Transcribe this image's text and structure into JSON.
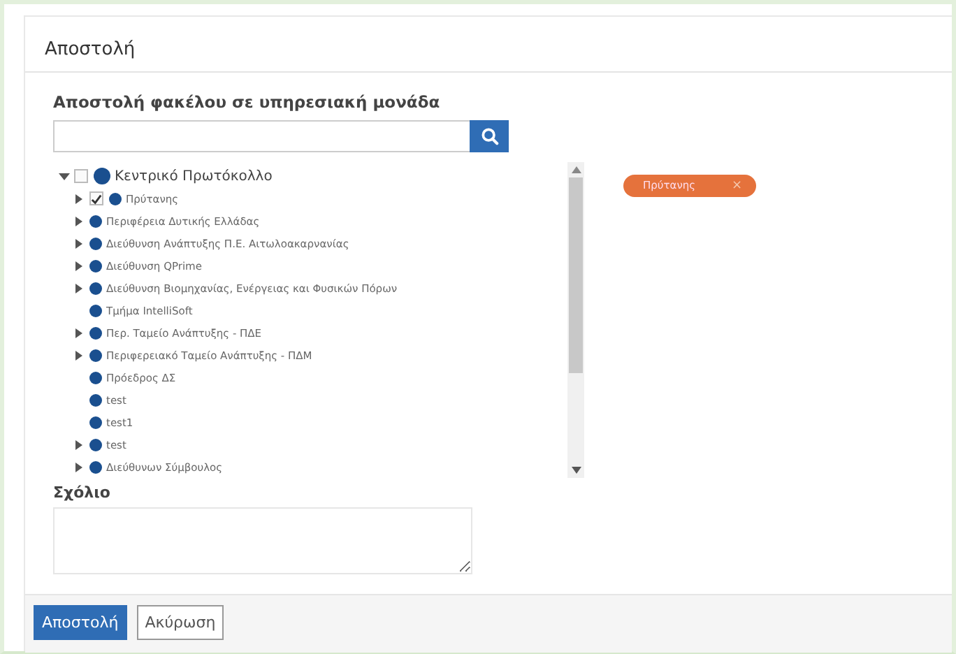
{
  "panel": {
    "title": "Αποστολή"
  },
  "form": {
    "label": "Αποστολή φακέλου σε υπηρεσιακή μονάδα"
  },
  "tree": [
    {
      "label": "Κεντρικό Πρωτόκολλο",
      "kind": "branch",
      "expanded": true,
      "checked": false,
      "children": [
        {
          "label": "Πρύτανης",
          "kind": "branch",
          "expanded": false,
          "checked": true
        },
        {
          "label": "Περιφέρεια Δυτικής Ελλάδας",
          "kind": "branch",
          "expanded": false
        },
        {
          "label": "Διεύθυνση Ανάπτυξης Π.Ε. Αιτωλοακαρνανίας",
          "kind": "branch",
          "expanded": false
        },
        {
          "label": "Διεύθυνση QPrime",
          "kind": "branch",
          "expanded": false
        },
        {
          "label": "Διεύθυνση Βιομηχανίας, Ενέργειας και Φυσικών Πόρων",
          "kind": "branch",
          "expanded": false
        },
        {
          "label": "Τμήμα IntelliSoft",
          "kind": "leaf"
        },
        {
          "label": "Περ. Ταμείο Ανάπτυξης - ΠΔΕ",
          "kind": "branch",
          "expanded": false
        },
        {
          "label": "Περιφερειακό Ταμείο Ανάπτυξης - ΠΔΜ",
          "kind": "branch",
          "expanded": false
        },
        {
          "label": "Πρόεδρος ΔΣ",
          "kind": "leaf"
        },
        {
          "label": "test",
          "kind": "leaf"
        },
        {
          "label": "test1",
          "kind": "leaf"
        },
        {
          "label": "test",
          "kind": "branch",
          "expanded": false
        },
        {
          "label": "Διεύθυνων Σύμβουλος",
          "kind": "branch",
          "expanded": false
        }
      ]
    }
  ],
  "selected_tags": [
    {
      "label": "Πρύτανης",
      "remove": "×"
    }
  ],
  "comment": {
    "label": "Σχόλιο"
  },
  "buttons": [
    {
      "label": "Αποστολή",
      "kind": "primary"
    },
    {
      "label": "Ακύρωση",
      "kind": "default"
    }
  ]
}
